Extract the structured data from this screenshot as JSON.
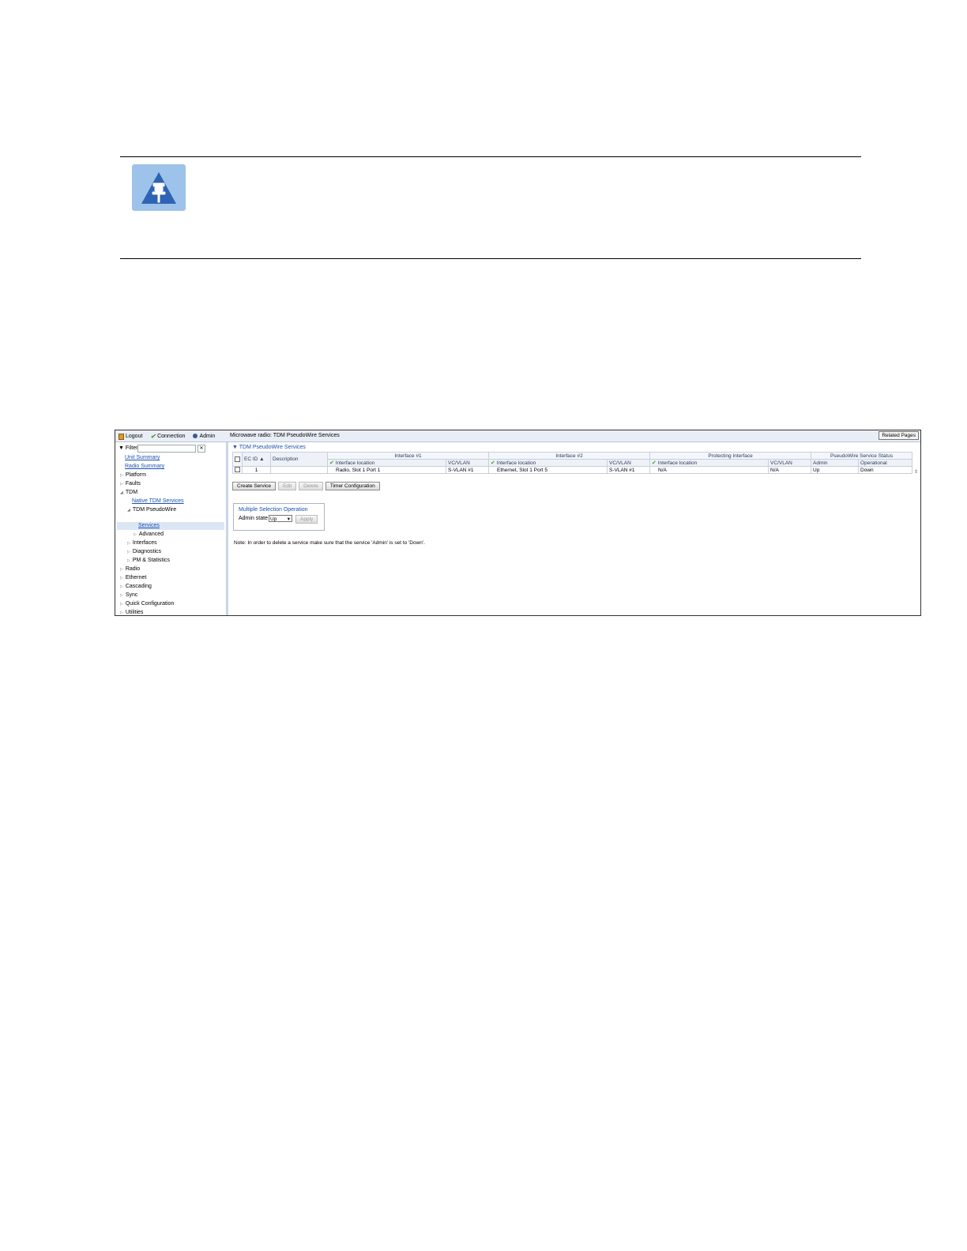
{
  "note": {
    "icon": "pushpin-icon"
  },
  "topbar": {
    "logout": "Logout",
    "connection": "Connection",
    "admin": "Admin",
    "title": "Microwave radio: TDM PseudoWire Services",
    "related": "Related Pages"
  },
  "sidebar": {
    "filter_label": "Filter",
    "items": [
      {
        "label": "Unit Summary"
      },
      {
        "label": "Radio Summary"
      },
      {
        "label": "Platform"
      },
      {
        "label": "Faults"
      },
      {
        "label": "TDM"
      },
      {
        "label": "Native TDM Services"
      },
      {
        "label": "TDM PseudoWire"
      },
      {
        "label": "Services"
      },
      {
        "label": "Advanced"
      },
      {
        "label": "Interfaces"
      },
      {
        "label": "Diagnostics"
      },
      {
        "label": "PM & Statistics"
      },
      {
        "label": "Radio"
      },
      {
        "label": "Ethernet"
      },
      {
        "label": "Cascading"
      },
      {
        "label": "Sync"
      },
      {
        "label": "Quick Configuration"
      },
      {
        "label": "Utilities"
      }
    ]
  },
  "main": {
    "section_title": "TDM PseudoWire Services",
    "groups": [
      "Interface #1",
      "Interface #2",
      "Protecting Interface",
      "PseudoWire Service Status"
    ],
    "col_ecid": "EC ID",
    "col_desc": "Description",
    "sub": {
      "if1_loc": "Interface location",
      "if1_vc": "VC/VLAN",
      "if2_loc": "Interface location",
      "if2_vc": "VC/VLAN",
      "pr_loc": "Interface location",
      "pr_vc": "VC/VLAN",
      "admin": "Admin",
      "oper": "Operational"
    },
    "row": {
      "ecid": "1",
      "desc": "",
      "if1_loc": "Radio, Slot 1 Port 1",
      "if1_vc": "S-VLAN #1",
      "if2_loc": "Ethernet, Slot 1 Port 5",
      "if2_vc": "S-VLAN #1",
      "pr_loc": "N/A",
      "pr_vc": "N/A",
      "admin": "Up",
      "oper": "Down"
    },
    "buttons": {
      "create": "Create Service",
      "edit": "Edit",
      "delete": "Delete",
      "timer": "Timer Configuration"
    },
    "mso": {
      "title": "Multiple Selection Operation",
      "admin_label": "Admin state",
      "admin_value": "Up",
      "apply": "Apply"
    },
    "note": "Note:  In order to delete a service make sure that the service 'Admin' is set to 'Down'."
  }
}
